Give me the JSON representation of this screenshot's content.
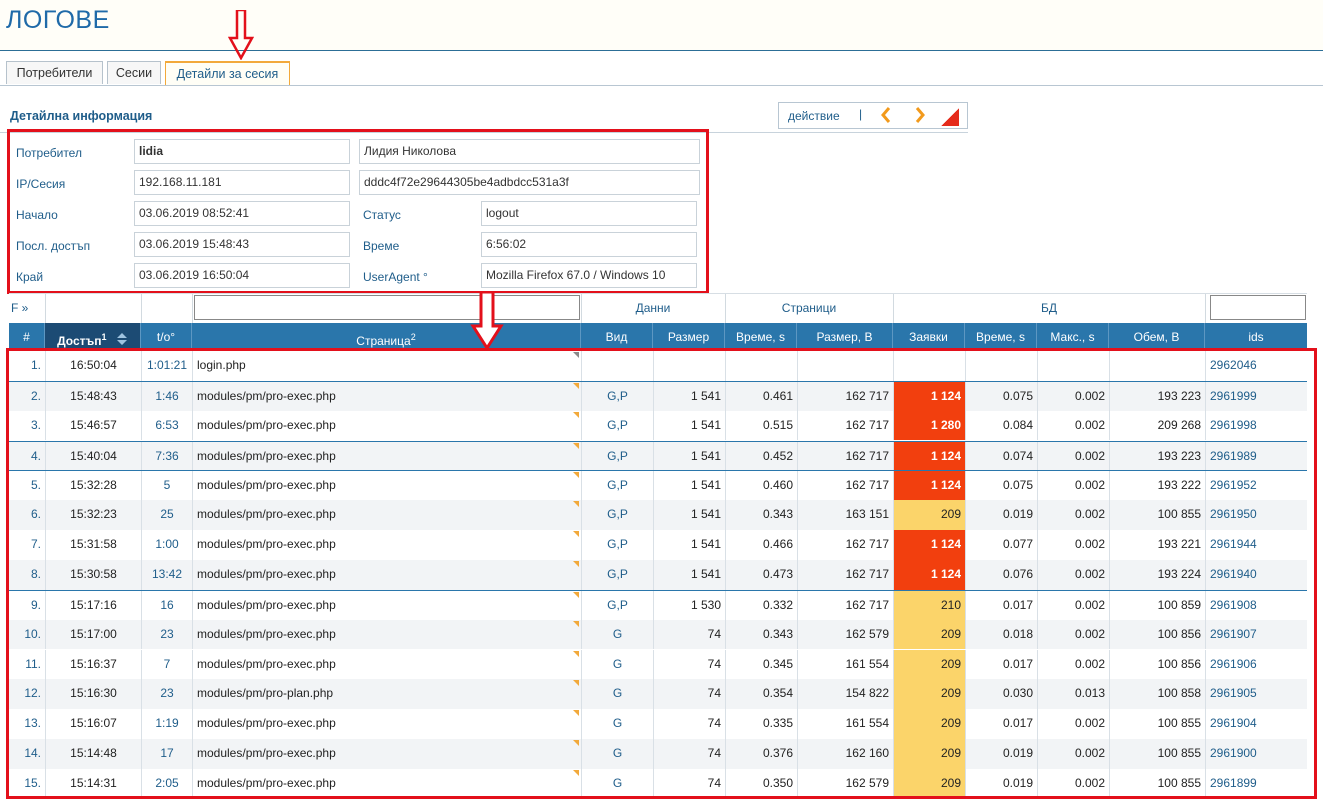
{
  "app": {
    "title": "ЛОГОВЕ"
  },
  "tabs": [
    {
      "label": "Потребители",
      "active": false
    },
    {
      "label": "Сесии",
      "active": false
    },
    {
      "label": "Детайли за сесия",
      "active": true
    }
  ],
  "section": {
    "title": "Детайлна информация"
  },
  "toolbar": {
    "action_label": "действие",
    "separator": "|",
    "prev_icon": "chevron-left-icon",
    "next_icon": "chevron-right-icon",
    "corner_icon": "red-corner-icon"
  },
  "details": {
    "user_label": "Потребител",
    "user_value": "lidia",
    "user_fullname": "Лидия Николова",
    "ip_label": "IP/Сесия",
    "ip_value": "192.168.11.181",
    "session_value": "dddc4f72e29644305be4adbdcc531a3f",
    "start_label": "Начало",
    "start_value": "03.06.2019 08:52:41",
    "status_label": "Статус",
    "status_value": "logout",
    "last_label": "Посл. достъп",
    "last_value": "03.06.2019 15:48:43",
    "time_label": "Време",
    "time_value": "6:56:02",
    "end_label": "Край",
    "end_value": "03.06.2019 16:50:04",
    "ua_label": "UserAgent °",
    "ua_value": "Mozilla Firefox 67.0 / Windows 10"
  },
  "table": {
    "filter_toggle": "F »",
    "groups": {
      "data": "Данни",
      "pages": "Страници",
      "db": "БД"
    },
    "headers": {
      "num": "#",
      "access": "Достъп",
      "access_sup": "1",
      "to": "t/o°",
      "page": "Страница",
      "page_sup": "2",
      "kind": "Вид",
      "size": "Размер",
      "time_s": "Време, s",
      "size_b": "Размер, B",
      "requests": "Заявки",
      "db_time": "Време, s",
      "max_s": "Макс., s",
      "volume": "Обем, B",
      "ids": "ids"
    },
    "rows": [
      {
        "num": "1.",
        "access": "16:50:04",
        "to": "1:01:21",
        "page": "login.php",
        "kind": "",
        "size": "",
        "time": "",
        "size_b": "",
        "req": "",
        "db_time": "",
        "max": "",
        "vol": "",
        "ids": "2962046",
        "zone": "none"
      },
      {
        "num": "2.",
        "access": "15:48:43",
        "to": "1:46",
        "page": "modules/pm/pro-exec.php",
        "kind": "G,P",
        "size": "1 541",
        "time": "0.461",
        "size_b": "162 717",
        "req": "1 124",
        "db_time": "0.075",
        "max": "0.002",
        "vol": "193 223",
        "ids": "2961999",
        "zone": "red"
      },
      {
        "num": "3.",
        "access": "15:46:57",
        "to": "6:53",
        "page": "modules/pm/pro-exec.php",
        "kind": "G,P",
        "size": "1 541",
        "time": "0.515",
        "size_b": "162 717",
        "req": "1 280",
        "db_time": "0.084",
        "max": "0.002",
        "vol": "209 268",
        "ids": "2961998",
        "zone": "red"
      },
      {
        "num": "4.",
        "access": "15:40:04",
        "to": "7:36",
        "page": "modules/pm/pro-exec.php",
        "kind": "G,P",
        "size": "1 541",
        "time": "0.452",
        "size_b": "162 717",
        "req": "1 124",
        "db_time": "0.074",
        "max": "0.002",
        "vol": "193 223",
        "ids": "2961989",
        "zone": "red"
      },
      {
        "num": "5.",
        "access": "15:32:28",
        "to": "5",
        "page": "modules/pm/pro-exec.php",
        "kind": "G,P",
        "size": "1 541",
        "time": "0.460",
        "size_b": "162 717",
        "req": "1 124",
        "db_time": "0.075",
        "max": "0.002",
        "vol": "193 222",
        "ids": "2961952",
        "zone": "red"
      },
      {
        "num": "6.",
        "access": "15:32:23",
        "to": "25",
        "page": "modules/pm/pro-exec.php",
        "kind": "G,P",
        "size": "1 541",
        "time": "0.343",
        "size_b": "163 151",
        "req": "209",
        "db_time": "0.019",
        "max": "0.002",
        "vol": "100 855",
        "ids": "2961950",
        "zone": "yellow"
      },
      {
        "num": "7.",
        "access": "15:31:58",
        "to": "1:00",
        "page": "modules/pm/pro-exec.php",
        "kind": "G,P",
        "size": "1 541",
        "time": "0.466",
        "size_b": "162 717",
        "req": "1 124",
        "db_time": "0.077",
        "max": "0.002",
        "vol": "193 221",
        "ids": "2961944",
        "zone": "red"
      },
      {
        "num": "8.",
        "access": "15:30:58",
        "to": "13:42",
        "page": "modules/pm/pro-exec.php",
        "kind": "G,P",
        "size": "1 541",
        "time": "0.473",
        "size_b": "162 717",
        "req": "1 124",
        "db_time": "0.076",
        "max": "0.002",
        "vol": "193 224",
        "ids": "2961940",
        "zone": "red"
      },
      {
        "num": "9.",
        "access": "15:17:16",
        "to": "16",
        "page": "modules/pm/pro-exec.php",
        "kind": "G,P",
        "size": "1 530",
        "time": "0.332",
        "size_b": "162 717",
        "req": "210",
        "db_time": "0.017",
        "max": "0.002",
        "vol": "100 859",
        "ids": "2961908",
        "zone": "yellow"
      },
      {
        "num": "10.",
        "access": "15:17:00",
        "to": "23",
        "page": "modules/pm/pro-exec.php",
        "kind": "G",
        "size": "74",
        "time": "0.343",
        "size_b": "162 579",
        "req": "209",
        "db_time": "0.018",
        "max": "0.002",
        "vol": "100 856",
        "ids": "2961907",
        "zone": "yellow"
      },
      {
        "num": "11.",
        "access": "15:16:37",
        "to": "7",
        "page": "modules/pm/pro-exec.php",
        "kind": "G",
        "size": "74",
        "time": "0.345",
        "size_b": "161 554",
        "req": "209",
        "db_time": "0.017",
        "max": "0.002",
        "vol": "100 856",
        "ids": "2961906",
        "zone": "yellow"
      },
      {
        "num": "12.",
        "access": "15:16:30",
        "to": "23",
        "page": "modules/pm/pro-plan.php",
        "kind": "G",
        "size": "74",
        "time": "0.354",
        "size_b": "154 822",
        "req": "209",
        "db_time": "0.030",
        "max": "0.013",
        "vol": "100 858",
        "ids": "2961905",
        "zone": "yellow"
      },
      {
        "num": "13.",
        "access": "15:16:07",
        "to": "1:19",
        "page": "modules/pm/pro-exec.php",
        "kind": "G",
        "size": "74",
        "time": "0.335",
        "size_b": "161 554",
        "req": "209",
        "db_time": "0.017",
        "max": "0.002",
        "vol": "100 855",
        "ids": "2961904",
        "zone": "yellow"
      },
      {
        "num": "14.",
        "access": "15:14:48",
        "to": "17",
        "page": "modules/pm/pro-exec.php",
        "kind": "G",
        "size": "74",
        "time": "0.376",
        "size_b": "162 160",
        "req": "209",
        "db_time": "0.019",
        "max": "0.002",
        "vol": "100 855",
        "ids": "2961900",
        "zone": "yellow"
      },
      {
        "num": "15.",
        "access": "15:14:31",
        "to": "2:05",
        "page": "modules/pm/pro-exec.php",
        "kind": "G",
        "size": "74",
        "time": "0.350",
        "size_b": "162 579",
        "req": "209",
        "db_time": "0.019",
        "max": "0.002",
        "vol": "100 855",
        "ids": "2961899",
        "zone": "yellow"
      }
    ]
  },
  "colors": {
    "accent": "#1f5d8a",
    "header": "#2a76ab",
    "highlight": "#e3101b",
    "zone_red": "#f23f0e",
    "zone_yellow": "#fbd46a",
    "tab_active": "#f2a93b"
  }
}
